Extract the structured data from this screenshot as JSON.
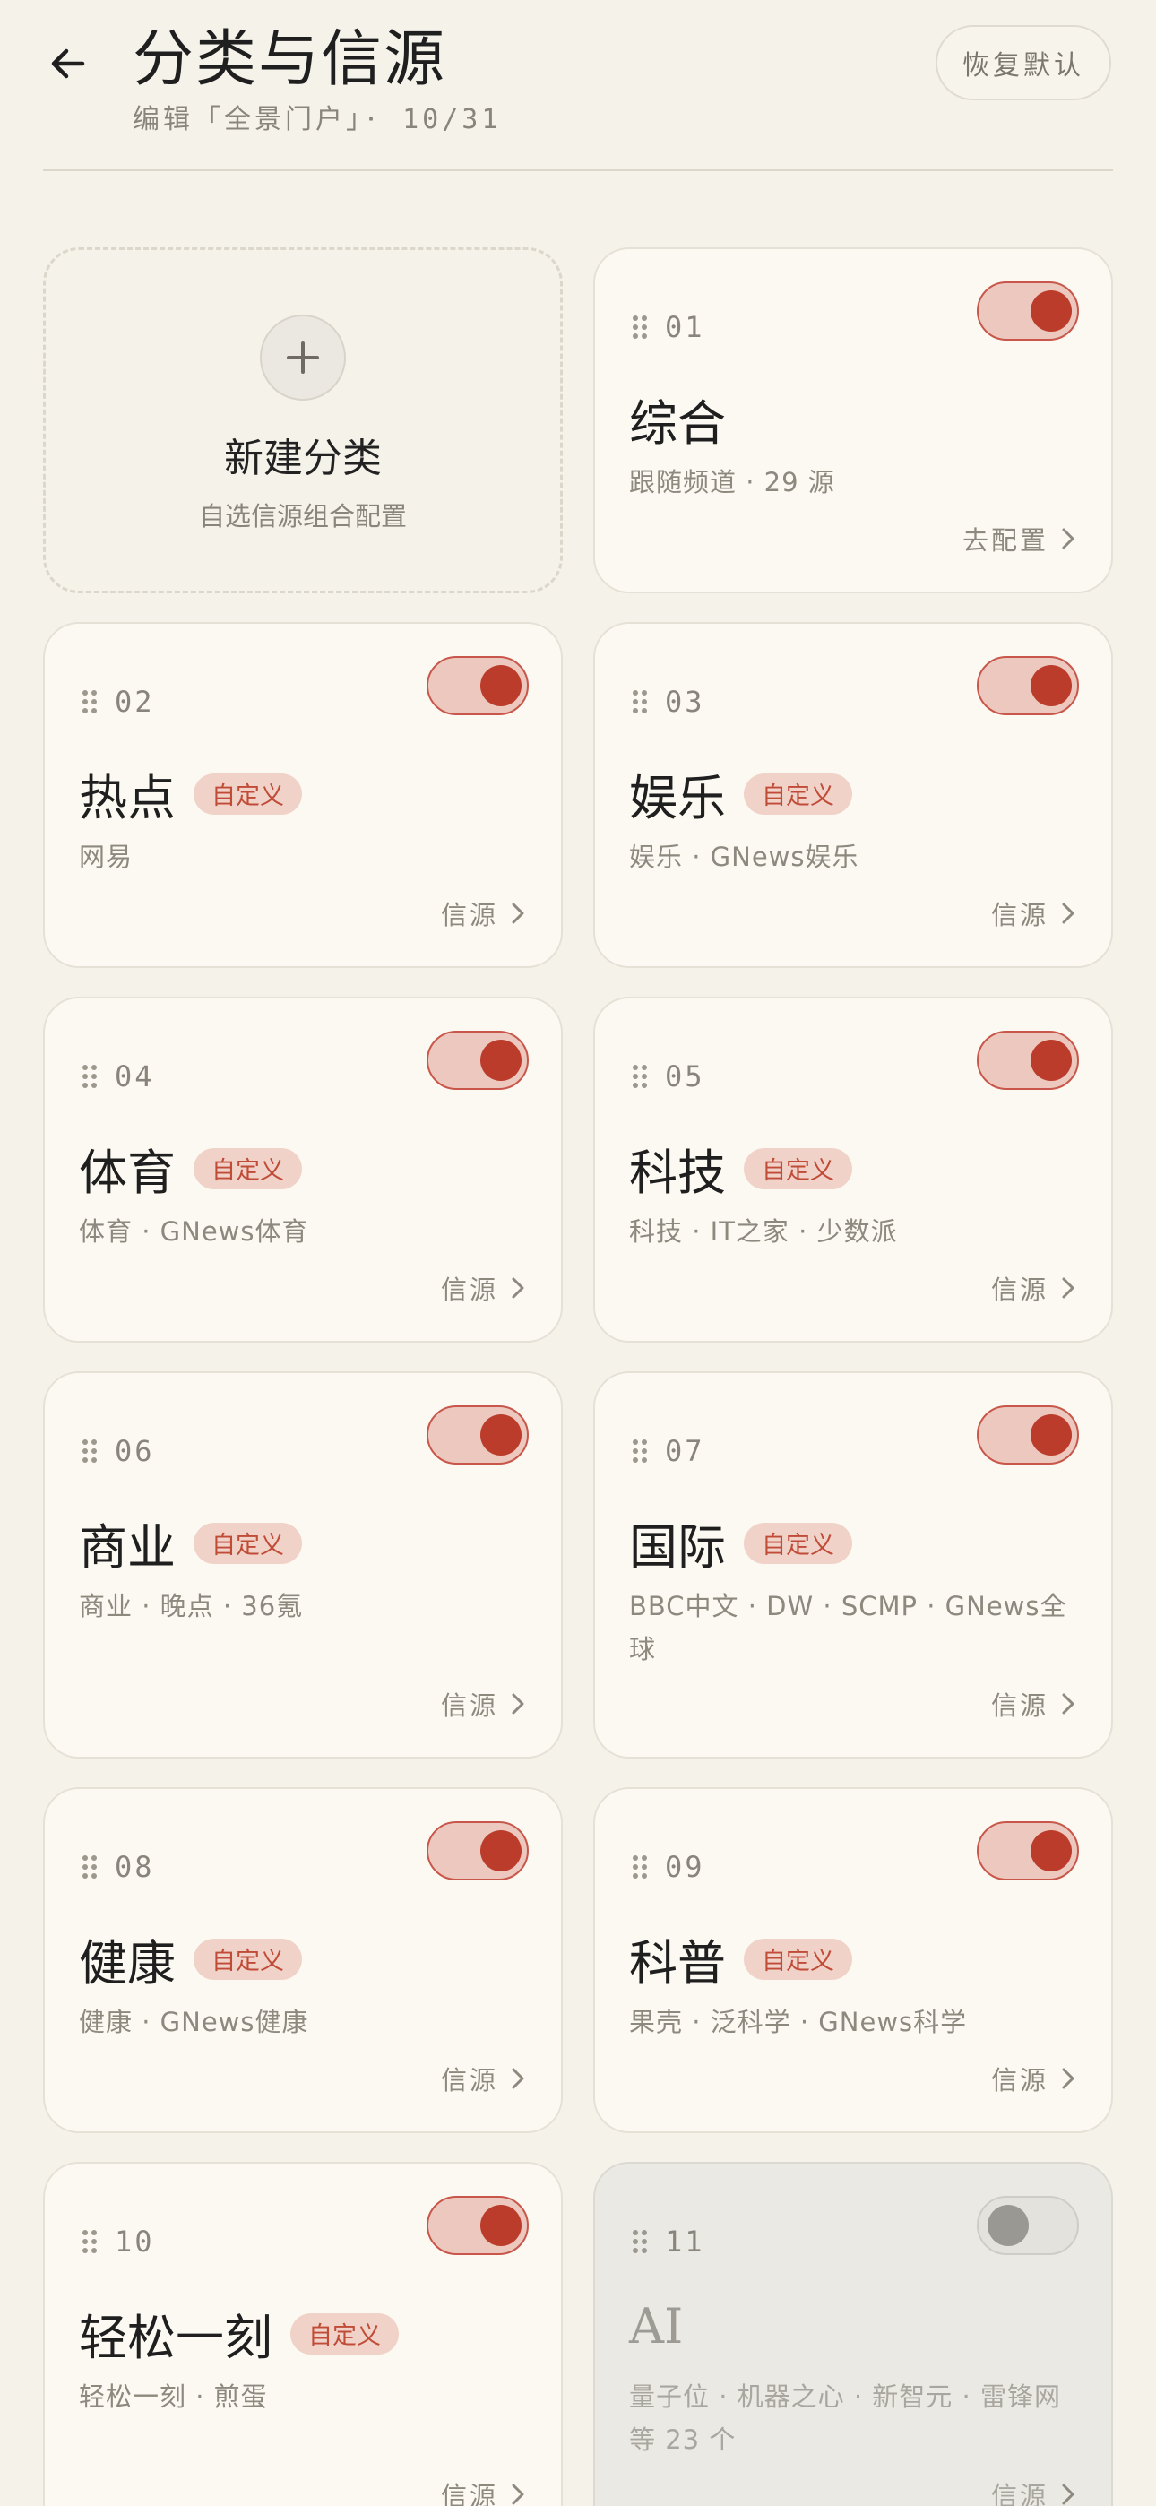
{
  "header": {
    "title": "分类与信源",
    "subtitle": "编辑「全景门户」· 10/31",
    "reset_label": "恢复默认"
  },
  "new_category": {
    "title": "新建分类",
    "subtitle": "自选信源组合配置"
  },
  "badge_label": "自定义",
  "categories": [
    {
      "index": "01",
      "name": "综合",
      "custom": false,
      "enabled": true,
      "sources": "跟随频道 · 29 源",
      "link": "去配置"
    },
    {
      "index": "02",
      "name": "热点",
      "custom": true,
      "enabled": true,
      "sources": "网易",
      "link": "信源"
    },
    {
      "index": "03",
      "name": "娱乐",
      "custom": true,
      "enabled": true,
      "sources": "娱乐 · GNews娱乐",
      "link": "信源"
    },
    {
      "index": "04",
      "name": "体育",
      "custom": true,
      "enabled": true,
      "sources": "体育 · GNews体育",
      "link": "信源"
    },
    {
      "index": "05",
      "name": "科技",
      "custom": true,
      "enabled": true,
      "sources": "科技 · IT之家 · 少数派",
      "link": "信源"
    },
    {
      "index": "06",
      "name": "商业",
      "custom": true,
      "enabled": true,
      "sources": "商业 · 晚点 · 36氪",
      "link": "信源"
    },
    {
      "index": "07",
      "name": "国际",
      "custom": true,
      "enabled": true,
      "sources": "BBC中文 · DW · SCMP · GNews全球",
      "link": "信源"
    },
    {
      "index": "08",
      "name": "健康",
      "custom": true,
      "enabled": true,
      "sources": "健康 · GNews健康",
      "link": "信源"
    },
    {
      "index": "09",
      "name": "科普",
      "custom": true,
      "enabled": true,
      "sources": "果壳 · 泛科学 · GNews科学",
      "link": "信源"
    },
    {
      "index": "10",
      "name": "轻松一刻",
      "custom": true,
      "enabled": true,
      "sources": "轻松一刻 · 煎蛋",
      "link": "信源"
    },
    {
      "index": "11",
      "name": "AI",
      "custom": false,
      "enabled": false,
      "sources": "量子位 · 机器之心 · 新智元 · 雷锋网 等 23 个",
      "link": "信源"
    }
  ]
}
